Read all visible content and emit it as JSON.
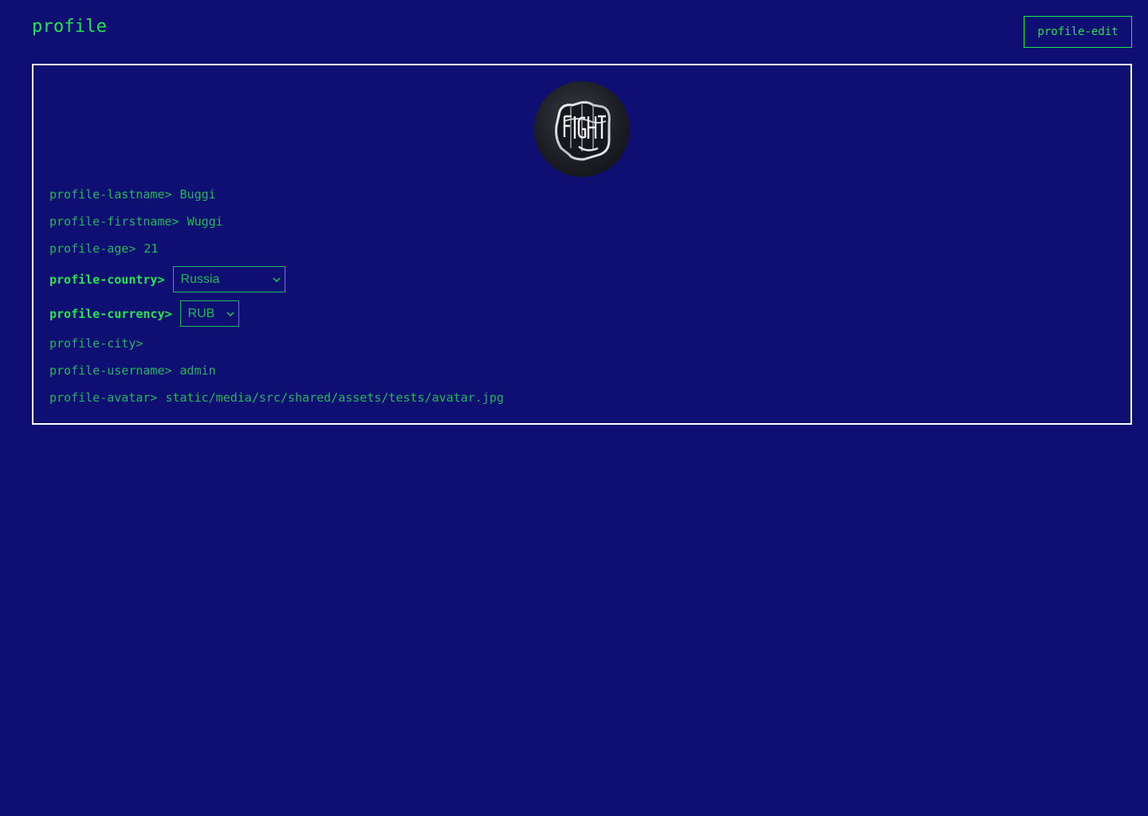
{
  "header": {
    "title": "profile",
    "edit_label": "profile-edit"
  },
  "profile": {
    "avatar_text": "FIGHT",
    "lastname": {
      "label": "profile-lastname>",
      "value": "Buggi"
    },
    "firstname": {
      "label": "profile-firstname>",
      "value": "Wuggi"
    },
    "age": {
      "label": "profile-age>",
      "value": "21"
    },
    "country": {
      "label": "profile-country>",
      "selected": "Russia"
    },
    "currency": {
      "label": "profile-currency>",
      "selected": "RUB"
    },
    "city": {
      "label": "profile-city>",
      "value": ""
    },
    "username": {
      "label": "profile-username>",
      "value": "admin"
    },
    "avatar": {
      "label": "profile-avatar>",
      "value": "static/media/src/shared/assets/tests/avatar.jpg"
    }
  },
  "colors": {
    "background": "#0e0e73",
    "accent": "#1fe84c",
    "text": "#1fb85a",
    "border": "#ffffff"
  },
  "icons": {
    "avatar": "fist-logo-icon",
    "select_arrow": "chevron-down-icon"
  }
}
